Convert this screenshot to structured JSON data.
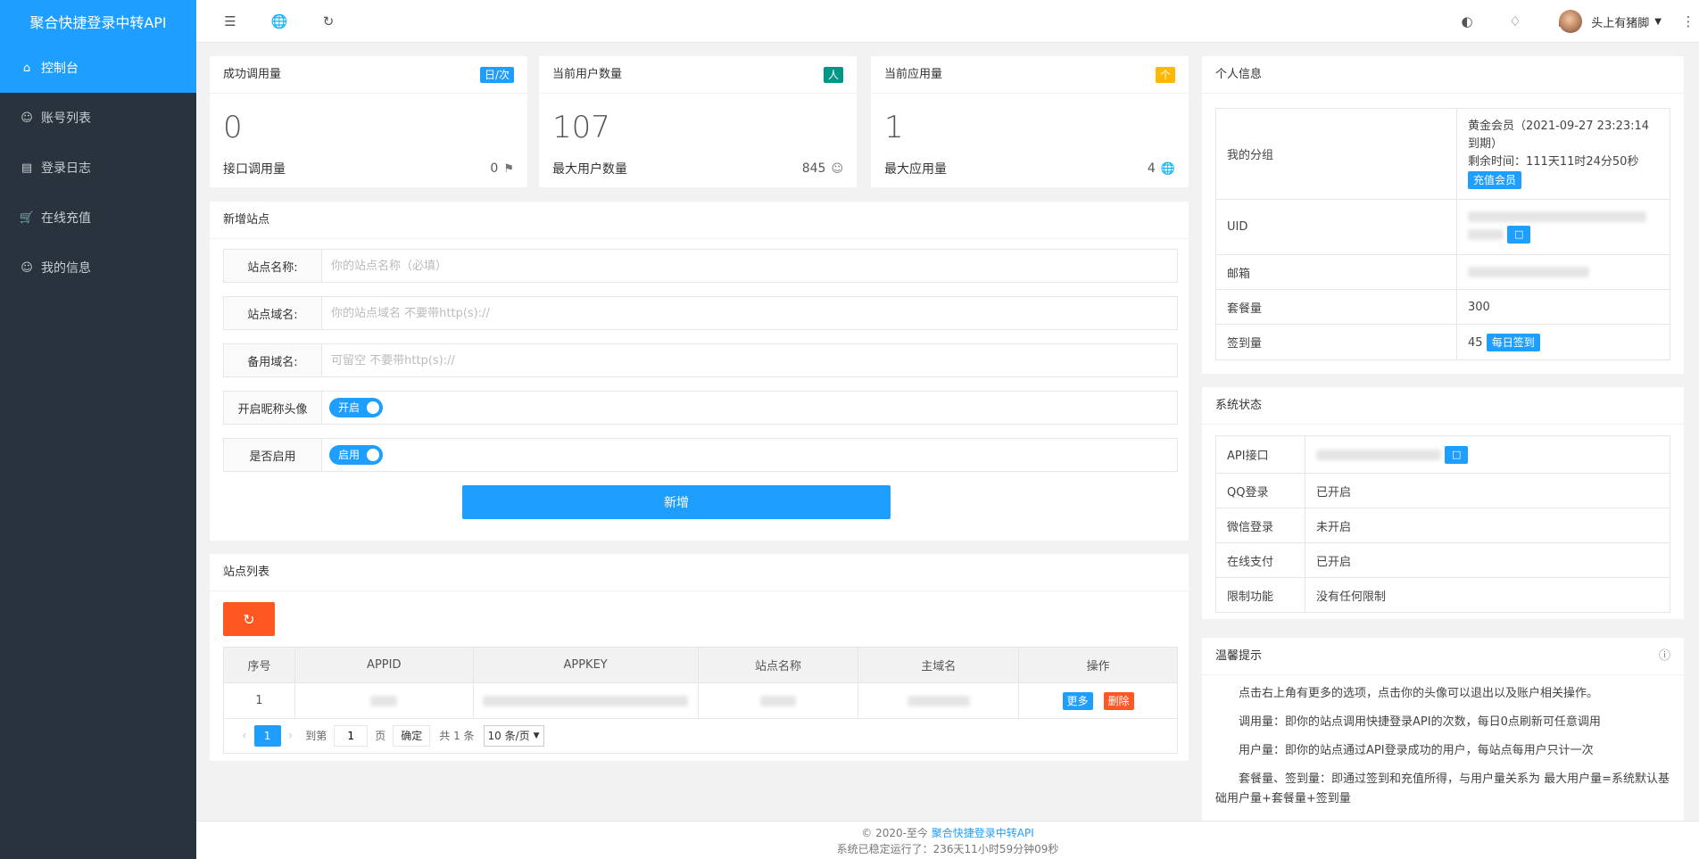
{
  "app": {
    "title": "聚合快捷登录中转API"
  },
  "sidebar": {
    "items": [
      {
        "label": "控制台",
        "icon": "home-icon",
        "active": true
      },
      {
        "label": "账号列表",
        "icon": "user-icon"
      },
      {
        "label": "登录日志",
        "icon": "log-icon"
      },
      {
        "label": "在线充值",
        "icon": "cart-icon"
      },
      {
        "label": "我的信息",
        "icon": "user-icon"
      }
    ]
  },
  "header": {
    "user_name": "头上有猪脚",
    "icons": [
      "menu-collapse-icon",
      "globe-icon",
      "refresh-icon",
      "theme-icon",
      "tag-icon",
      "fullscreen-icon",
      "more-icon"
    ]
  },
  "stats": [
    {
      "title": "成功调用量",
      "badge": "日/次",
      "badge_color": "#1e9fff",
      "value": "0",
      "sub_label": "接口调用量",
      "sub_value": "0",
      "icon": "flag-icon"
    },
    {
      "title": "当前用户数量",
      "badge": "人",
      "badge_color": "#009688",
      "value": "107",
      "sub_label": "最大用户数量",
      "sub_value": "845",
      "icon": "user-icon"
    },
    {
      "title": "当前应用量",
      "badge": "个",
      "badge_color": "#ffb800",
      "value": "1",
      "sub_label": "最大应用量",
      "sub_value": "4",
      "icon": "globe-icon"
    }
  ],
  "add_site": {
    "title": "新增站点",
    "fields": [
      {
        "label": "站点名称:",
        "placeholder": "你的站点名称（必填）"
      },
      {
        "label": "站点域名:",
        "placeholder": "你的站点域名 不要带http(s)://"
      },
      {
        "label": "备用域名:",
        "placeholder": "可留空 不要带http(s)://"
      }
    ],
    "switches": [
      {
        "label": "开启昵称头像",
        "value": "开启"
      },
      {
        "label": "是否启用",
        "value": "启用"
      }
    ],
    "submit": "新增"
  },
  "site_list": {
    "title": "站点列表",
    "columns": [
      "序号",
      "APPID",
      "APPKEY",
      "站点名称",
      "主域名",
      "操作"
    ],
    "rows": [
      {
        "index": "1"
      }
    ],
    "actions": {
      "more": "更多",
      "delete": "删除"
    },
    "pager": {
      "current": "1",
      "goto": "到第",
      "page_input": "1",
      "page_unit": "页",
      "confirm": "确定",
      "total": "共 1 条",
      "page_size": "10 条/页"
    }
  },
  "profile": {
    "title": "个人信息",
    "group_label": "我的分组",
    "group_value": "黄金会员（2021-09-27 23:23:14 到期）",
    "remain": "剩余时间：111天11时24分50秒",
    "recharge": "充值会员",
    "uid_label": "UID",
    "email_label": "邮箱",
    "package_label": "套餐量",
    "package_value": "300",
    "sign_label": "签到量",
    "sign_value": "45",
    "sign_button": "每日签到"
  },
  "system": {
    "title": "系统状态",
    "rows": [
      {
        "k": "API接口",
        "v": ""
      },
      {
        "k": "QQ登录",
        "v": "已开启"
      },
      {
        "k": "微信登录",
        "v": "未开启"
      },
      {
        "k": "在线支付",
        "v": "已开启"
      },
      {
        "k": "限制功能",
        "v": "没有任何限制"
      }
    ]
  },
  "tips": {
    "title": "温馨提示",
    "items": [
      "点击右上角有更多的选项，点击你的头像可以退出以及账户相关操作。",
      "调用量：即你的站点调用快捷登录API的次数，每日0点刷新可任意调用",
      "用户量：即你的站点通过API登录成功的用户，每站点每用户只计一次",
      "套餐量、签到量：即通过签到和充值所得，与用户量关系为 最大用户量=系统默认基础用户量+套餐量+签到量"
    ]
  },
  "footer": {
    "copyright": "© 2020-至今 ",
    "link": "聚合快捷登录中转API",
    "uptime": "系统已稳定运行了：236天11小时59分钟09秒"
  }
}
